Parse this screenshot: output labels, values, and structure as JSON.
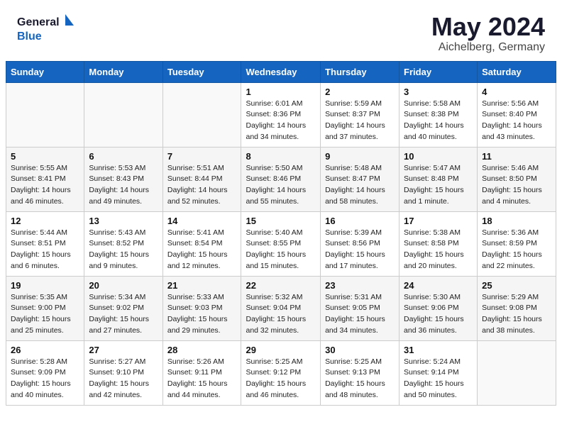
{
  "header": {
    "logo_line1": "General",
    "logo_line2": "Blue",
    "month_title": "May 2024",
    "location": "Aichelberg, Germany"
  },
  "weekdays": [
    "Sunday",
    "Monday",
    "Tuesday",
    "Wednesday",
    "Thursday",
    "Friday",
    "Saturday"
  ],
  "rows": [
    [
      {
        "day": "",
        "info": ""
      },
      {
        "day": "",
        "info": ""
      },
      {
        "day": "",
        "info": ""
      },
      {
        "day": "1",
        "info": "Sunrise: 6:01 AM\nSunset: 8:36 PM\nDaylight: 14 hours\nand 34 minutes."
      },
      {
        "day": "2",
        "info": "Sunrise: 5:59 AM\nSunset: 8:37 PM\nDaylight: 14 hours\nand 37 minutes."
      },
      {
        "day": "3",
        "info": "Sunrise: 5:58 AM\nSunset: 8:38 PM\nDaylight: 14 hours\nand 40 minutes."
      },
      {
        "day": "4",
        "info": "Sunrise: 5:56 AM\nSunset: 8:40 PM\nDaylight: 14 hours\nand 43 minutes."
      }
    ],
    [
      {
        "day": "5",
        "info": "Sunrise: 5:55 AM\nSunset: 8:41 PM\nDaylight: 14 hours\nand 46 minutes."
      },
      {
        "day": "6",
        "info": "Sunrise: 5:53 AM\nSunset: 8:43 PM\nDaylight: 14 hours\nand 49 minutes."
      },
      {
        "day": "7",
        "info": "Sunrise: 5:51 AM\nSunset: 8:44 PM\nDaylight: 14 hours\nand 52 minutes."
      },
      {
        "day": "8",
        "info": "Sunrise: 5:50 AM\nSunset: 8:46 PM\nDaylight: 14 hours\nand 55 minutes."
      },
      {
        "day": "9",
        "info": "Sunrise: 5:48 AM\nSunset: 8:47 PM\nDaylight: 14 hours\nand 58 minutes."
      },
      {
        "day": "10",
        "info": "Sunrise: 5:47 AM\nSunset: 8:48 PM\nDaylight: 15 hours\nand 1 minute."
      },
      {
        "day": "11",
        "info": "Sunrise: 5:46 AM\nSunset: 8:50 PM\nDaylight: 15 hours\nand 4 minutes."
      }
    ],
    [
      {
        "day": "12",
        "info": "Sunrise: 5:44 AM\nSunset: 8:51 PM\nDaylight: 15 hours\nand 6 minutes."
      },
      {
        "day": "13",
        "info": "Sunrise: 5:43 AM\nSunset: 8:52 PM\nDaylight: 15 hours\nand 9 minutes."
      },
      {
        "day": "14",
        "info": "Sunrise: 5:41 AM\nSunset: 8:54 PM\nDaylight: 15 hours\nand 12 minutes."
      },
      {
        "day": "15",
        "info": "Sunrise: 5:40 AM\nSunset: 8:55 PM\nDaylight: 15 hours\nand 15 minutes."
      },
      {
        "day": "16",
        "info": "Sunrise: 5:39 AM\nSunset: 8:56 PM\nDaylight: 15 hours\nand 17 minutes."
      },
      {
        "day": "17",
        "info": "Sunrise: 5:38 AM\nSunset: 8:58 PM\nDaylight: 15 hours\nand 20 minutes."
      },
      {
        "day": "18",
        "info": "Sunrise: 5:36 AM\nSunset: 8:59 PM\nDaylight: 15 hours\nand 22 minutes."
      }
    ],
    [
      {
        "day": "19",
        "info": "Sunrise: 5:35 AM\nSunset: 9:00 PM\nDaylight: 15 hours\nand 25 minutes."
      },
      {
        "day": "20",
        "info": "Sunrise: 5:34 AM\nSunset: 9:02 PM\nDaylight: 15 hours\nand 27 minutes."
      },
      {
        "day": "21",
        "info": "Sunrise: 5:33 AM\nSunset: 9:03 PM\nDaylight: 15 hours\nand 29 minutes."
      },
      {
        "day": "22",
        "info": "Sunrise: 5:32 AM\nSunset: 9:04 PM\nDaylight: 15 hours\nand 32 minutes."
      },
      {
        "day": "23",
        "info": "Sunrise: 5:31 AM\nSunset: 9:05 PM\nDaylight: 15 hours\nand 34 minutes."
      },
      {
        "day": "24",
        "info": "Sunrise: 5:30 AM\nSunset: 9:06 PM\nDaylight: 15 hours\nand 36 minutes."
      },
      {
        "day": "25",
        "info": "Sunrise: 5:29 AM\nSunset: 9:08 PM\nDaylight: 15 hours\nand 38 minutes."
      }
    ],
    [
      {
        "day": "26",
        "info": "Sunrise: 5:28 AM\nSunset: 9:09 PM\nDaylight: 15 hours\nand 40 minutes."
      },
      {
        "day": "27",
        "info": "Sunrise: 5:27 AM\nSunset: 9:10 PM\nDaylight: 15 hours\nand 42 minutes."
      },
      {
        "day": "28",
        "info": "Sunrise: 5:26 AM\nSunset: 9:11 PM\nDaylight: 15 hours\nand 44 minutes."
      },
      {
        "day": "29",
        "info": "Sunrise: 5:25 AM\nSunset: 9:12 PM\nDaylight: 15 hours\nand 46 minutes."
      },
      {
        "day": "30",
        "info": "Sunrise: 5:25 AM\nSunset: 9:13 PM\nDaylight: 15 hours\nand 48 minutes."
      },
      {
        "day": "31",
        "info": "Sunrise: 5:24 AM\nSunset: 9:14 PM\nDaylight: 15 hours\nand 50 minutes."
      },
      {
        "day": "",
        "info": ""
      }
    ]
  ]
}
